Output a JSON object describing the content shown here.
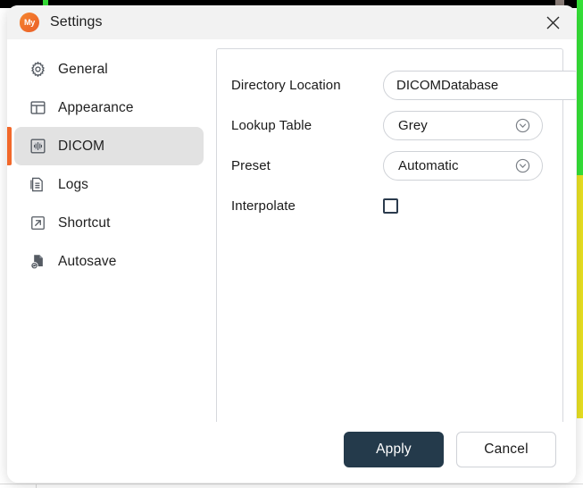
{
  "window": {
    "title": "Settings",
    "logo_text": "My",
    "close_icon": "close-icon"
  },
  "sidebar": {
    "items": [
      {
        "label": "General",
        "icon": "gear-icon",
        "active": false
      },
      {
        "label": "Appearance",
        "icon": "layout-icon",
        "active": false
      },
      {
        "label": "DICOM",
        "icon": "xray-icon",
        "active": true
      },
      {
        "label": "Logs",
        "icon": "document-list-icon",
        "active": false
      },
      {
        "label": "Shortcut",
        "icon": "arrow-out-icon",
        "active": false
      },
      {
        "label": "Autosave",
        "icon": "autosave-icon",
        "active": false
      }
    ]
  },
  "form": {
    "directory_location": {
      "label": "Directory Location",
      "value": "DICOMDatabase",
      "placeholder": "DICOMDatabase",
      "browse_icon": "folder-icon"
    },
    "lookup_table": {
      "label": "Lookup Table",
      "value": "Grey",
      "chevron_icon": "chevron-down-circle-icon"
    },
    "preset": {
      "label": "Preset",
      "value": "Automatic",
      "chevron_icon": "chevron-down-circle-icon"
    },
    "interpolate": {
      "label": "Interpolate",
      "checked": false
    }
  },
  "footer": {
    "apply_label": "Apply",
    "cancel_label": "Cancel"
  },
  "colors": {
    "accent_orange": "#f2682a",
    "primary_button": "#243a4b",
    "titlebar_bg": "#f2f2f2",
    "active_item_bg": "#e2e2e2",
    "backdrop_green": "#35e037",
    "backdrop_yellow": "#e8e022"
  },
  "backdrop": {
    "dots": "⋯"
  }
}
